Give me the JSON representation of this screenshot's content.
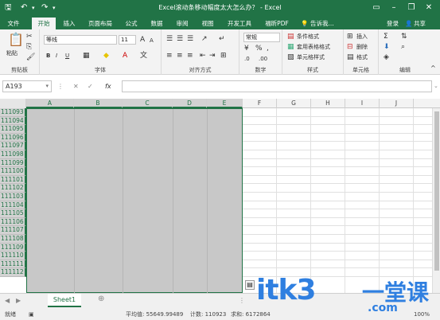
{
  "titlebar": {
    "title": "Excel滚动条移动幅度太大怎么办？ - Excel",
    "save_icon": "save-icon",
    "undo_icon": "undo-icon",
    "redo_icon": "redo-icon",
    "min": "–",
    "restore": "❐",
    "close": "✕",
    "ribbon_opt": "▭"
  },
  "tabs": [
    "文件",
    "开始",
    "插入",
    "页面布局",
    "公式",
    "数据",
    "审阅",
    "视图",
    "开发工具",
    "福昕PDF"
  ],
  "tell_me": "告诉我...",
  "login": "登录",
  "share": "共享",
  "ribbon": {
    "clipboard": {
      "paste": "粘贴",
      "label": "剪贴板"
    },
    "font": {
      "name": "等线",
      "size": "11",
      "label": "字体",
      "bold": "B",
      "italic": "I",
      "underline": "U"
    },
    "align": {
      "label": "对齐方式"
    },
    "number": {
      "format": "常规",
      "label": "数字"
    },
    "styles": {
      "cond": "条件格式",
      "table": "套用表格格式",
      "cell": "单元格样式",
      "label": "样式"
    },
    "cells": {
      "insert": "插入",
      "delete": "删除",
      "format": "格式",
      "label": "单元格"
    },
    "edit": {
      "label": "编辑"
    }
  },
  "namebox": "A193",
  "fx": "fx",
  "columns": [
    "A",
    "B",
    "C",
    "D",
    "E",
    "F",
    "G",
    "H",
    "I",
    "J"
  ],
  "rows": [
    "111093",
    "111094",
    "111095",
    "111096",
    "111097",
    "111098",
    "111099",
    "111100",
    "111101",
    "111102",
    "111103",
    "111104",
    "111105",
    "111106",
    "111107",
    "111108",
    "111109",
    "111110",
    "111111",
    "111112"
  ],
  "sheet": "Sheet1",
  "status": {
    "ready": "就绪",
    "avg": "平均值: 55649.99489",
    "count": "计数: 110923",
    "sum": "求和: 6172864",
    "zoom": "100%"
  },
  "watermark": {
    "site": "itk3",
    "dotcom": ".com",
    "cn": "一堂课"
  }
}
